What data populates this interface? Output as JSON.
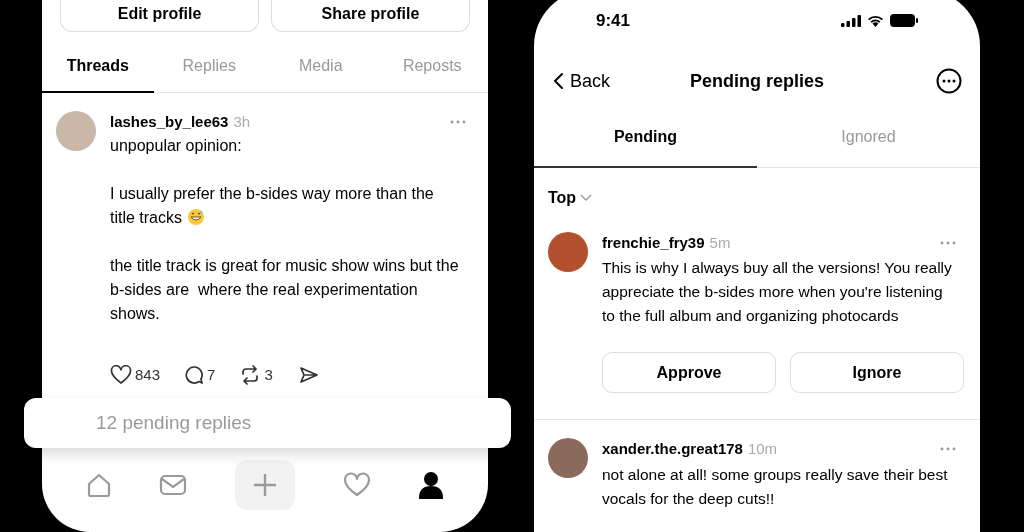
{
  "profile_screen": {
    "profile_buttons": [
      "Edit profile",
      "Share profile"
    ],
    "tabs": [
      {
        "label": "Threads",
        "selected": true
      },
      {
        "label": "Replies",
        "selected": false
      },
      {
        "label": "Media",
        "selected": false
      },
      {
        "label": "Reposts",
        "selected": false
      }
    ],
    "post": {
      "username": "lashes_by_lee63",
      "time": "3h",
      "paragraphs": [
        "unpopular opinion:",
        "I usually prefer the b-sides way more than the title tracks",
        "the title track is great for music show wins but the b-sides are  where the real experimentation shows."
      ],
      "likes": "843",
      "comments": "7",
      "reposts": "3"
    },
    "pending_banner": "12 pending replies",
    "bottom_nav": [
      {
        "kind": "home",
        "selected": false
      },
      {
        "kind": "mail",
        "selected": false
      },
      {
        "kind": "compose",
        "selected": false
      },
      {
        "kind": "activity",
        "selected": false
      },
      {
        "kind": "profile",
        "selected": true
      }
    ]
  },
  "pending_screen": {
    "status_bar": {
      "time": "9:41"
    },
    "back": "Back",
    "title": "Pending replies",
    "tabs": [
      {
        "label": "Pending",
        "selected": true
      },
      {
        "label": "Ignored",
        "selected": false
      }
    ],
    "sort": "Top",
    "replies": [
      {
        "username": "frenchie_fry39",
        "time": "5m",
        "text": "This is why I always buy all the versions! You really appreciate the b-sides more when you're listening to the full album and organizing photocards",
        "actions": [
          "Approve",
          "Ignore"
        ]
      },
      {
        "username": "xander.the.great178",
        "time": "10m",
        "text": "not alone at all! some groups really save their best vocals for the deep cuts!!"
      }
    ]
  }
}
